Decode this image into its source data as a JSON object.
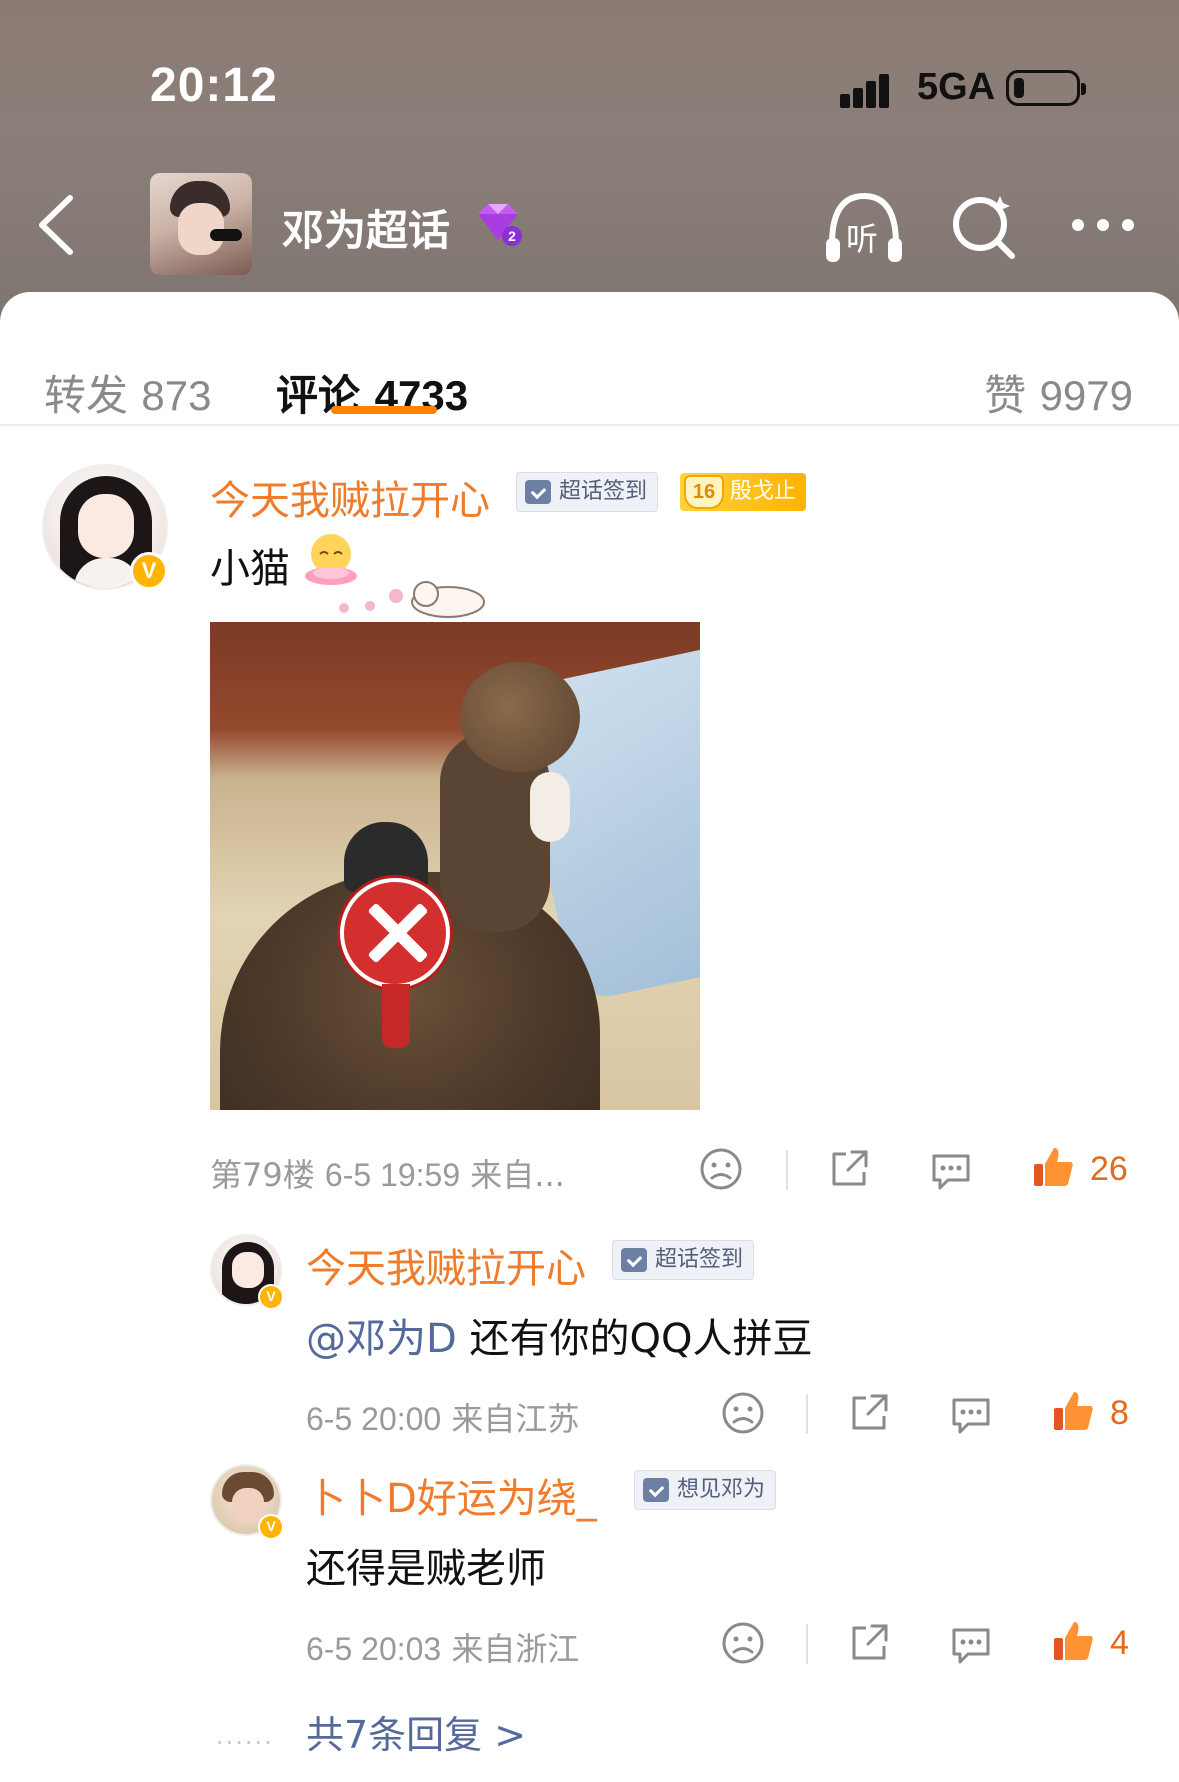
{
  "status_bar": {
    "time": "20:12",
    "network": "5GA",
    "battery_level": 0.15
  },
  "header": {
    "topic_title": "邓为超话",
    "icons": [
      "back-icon",
      "gem-level-icon",
      "listen-icon",
      "search-icon",
      "more-icon"
    ],
    "listen_label": "听"
  },
  "tabs": [
    {
      "label": "转发",
      "count": "873"
    },
    {
      "label": "评论",
      "count": "4733",
      "active": true
    },
    {
      "label": "赞",
      "count": "9979"
    }
  ],
  "colors": {
    "accent": "#ff8200",
    "username": "#f07b2a",
    "link": "#55699b",
    "meta": "#9a9a9a"
  },
  "comment": {
    "username": "今天我贼拉开心",
    "tags": {
      "signin": "超话签到",
      "rank_level": "16",
      "rank_name": "殷戈止"
    },
    "text": "小猫",
    "floor": "第79楼",
    "datetime": "6-5 19:59",
    "source": "来自...",
    "likes": "26"
  },
  "replies": [
    {
      "username": "今天我贼拉开心",
      "tag": "超话签到",
      "mention": "@邓为D",
      "text": " 还有你的QQ人拼豆",
      "datetime": "6-5 20:00",
      "source": "来自江苏",
      "likes": "8"
    },
    {
      "username": "卜卜D好运为绕_",
      "tag": "想见邓为",
      "text": "还得是贼老师",
      "datetime": "6-5 20:03",
      "source": "来自浙江",
      "likes": "4"
    }
  ],
  "more_replies": {
    "dots": "......",
    "label": "共7条回复 >"
  }
}
